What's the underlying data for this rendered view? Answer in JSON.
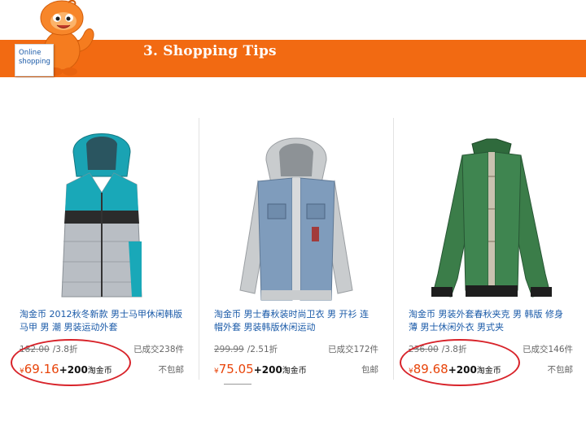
{
  "header": {
    "title": "3. Shopping Tips",
    "logo_line1": "Online",
    "logo_line2": "shopping",
    "banner_color": "#f26a12"
  },
  "products": [
    {
      "title": "淘金币 2012秋冬新款 男士马甲休闲韩版 马甲 男 潮 男装运动外套",
      "old_price": "182.00",
      "discount": "/3.8折",
      "sold": "已成交238件",
      "currency": "¥",
      "price": "69.16",
      "coins": "+200",
      "coins_label": "淘金币",
      "shipping": "不包邮",
      "image": "teal-grey-hooded-vest"
    },
    {
      "title": "淘金币 男士春秋装时尚卫衣 男 开衫 连帽外套 男装韩版休闲运动",
      "old_price": "299.99",
      "discount": "/2.51折",
      "sold": "已成交172件",
      "currency": "¥",
      "price": "75.05",
      "coins": "+200",
      "coins_label": "淘金币",
      "shipping": "包邮",
      "image": "denim-grey-hooded-jacket"
    },
    {
      "title": "淘金币 男装外套春秋夹克 男 韩版 修身薄 男士休闲外衣 男式夹",
      "old_price": "236.00",
      "discount": "/3.8折",
      "sold": "已成交146件",
      "currency": "¥",
      "price": "89.68",
      "coins": "+200",
      "coins_label": "淘金币",
      "shipping": "不包邮",
      "image": "green-zip-jacket"
    }
  ],
  "colors": {
    "price": "#e8440a",
    "link": "#1a5aa8",
    "highlight_circle": "#d8232a"
  }
}
